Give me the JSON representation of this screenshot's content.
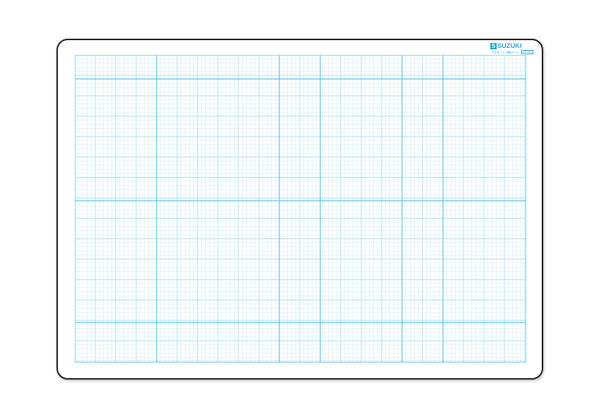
{
  "brand": {
    "logo_mark": "S",
    "name": "SUZUKI",
    "subtitle": "マグネット方眼ボード",
    "product_code": "MG-000"
  },
  "colors": {
    "board_border": "#1c1c1c",
    "grid_fine": "#cdeaf6",
    "grid_medium": "#8fd2ee",
    "grid_major": "#3fb6e6",
    "brand_blue": "#1aa3e0"
  },
  "icons": {
    "logo": "suzuki-logo-icon"
  }
}
